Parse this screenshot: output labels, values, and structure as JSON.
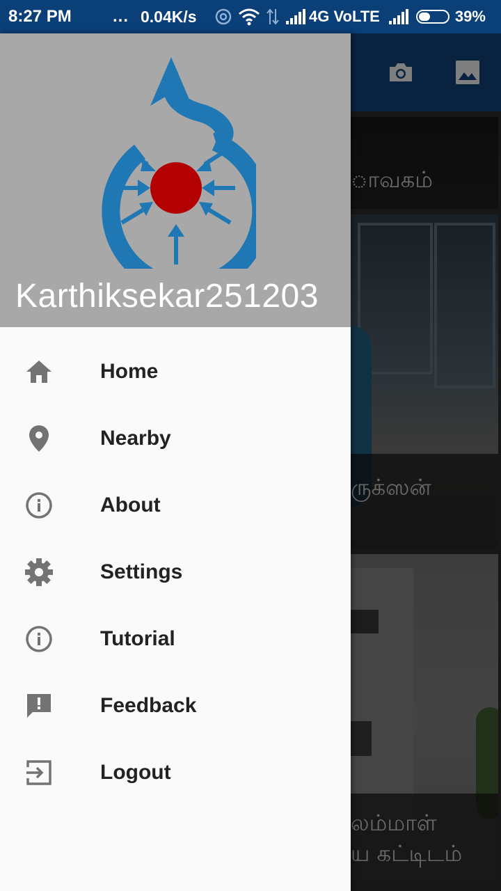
{
  "status_bar": {
    "time": "8:27 PM",
    "dots": "...",
    "speed": "0.04K/s",
    "network": "4G VoLTE",
    "battery": "39%",
    "battery_level": 0.39
  },
  "toolbar": {
    "icons": [
      "camera-icon",
      "gallery-icon"
    ]
  },
  "background_cards": [
    {
      "caption": "ாவகம்"
    },
    {
      "caption": "ருக்ஸன்"
    },
    {
      "caption_line1": "லம்மாள்",
      "caption_line2": "ய கட்டிடம்"
    }
  ],
  "drawer": {
    "username": "Karthiksekar251203",
    "menu": [
      {
        "label": "Home",
        "icon": "home-icon"
      },
      {
        "label": "Nearby",
        "icon": "location-pin-icon"
      },
      {
        "label": "About",
        "icon": "info-icon"
      },
      {
        "label": "Settings",
        "icon": "gear-icon"
      },
      {
        "label": "Tutorial",
        "icon": "info-icon"
      },
      {
        "label": "Feedback",
        "icon": "feedback-icon"
      },
      {
        "label": "Logout",
        "icon": "logout-icon"
      }
    ]
  },
  "colors": {
    "status_bar": "#0b3f78",
    "toolbar": "#0f3f75",
    "header": "#a8a8a8",
    "logo_blue": "#1f78b4",
    "logo_red": "#b30000",
    "icon_gray": "#737373"
  }
}
